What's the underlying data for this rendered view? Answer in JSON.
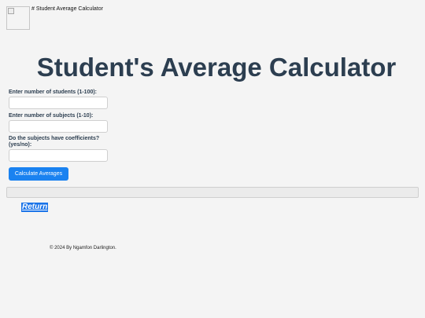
{
  "header": {
    "image_alt": "# Student Average Calculator"
  },
  "title": "Student's Average Calculator",
  "form": {
    "students_label": "Enter number of students (1-100):",
    "students_value": "",
    "subjects_label": "Enter number of subjects (1-10):",
    "subjects_value": "",
    "coefficients_label": "Do the subjects have coefficients? (yes/no):",
    "coefficients_value": "",
    "submit_label": "Calculate Averages"
  },
  "results": {
    "text": ""
  },
  "return_link": "Return",
  "footer": "© 2024 By Ngamfon Darlington.",
  "colors": {
    "primary_button": "#1a82f0",
    "title_text": "#2c3e50",
    "background": "#f4f4f4"
  }
}
